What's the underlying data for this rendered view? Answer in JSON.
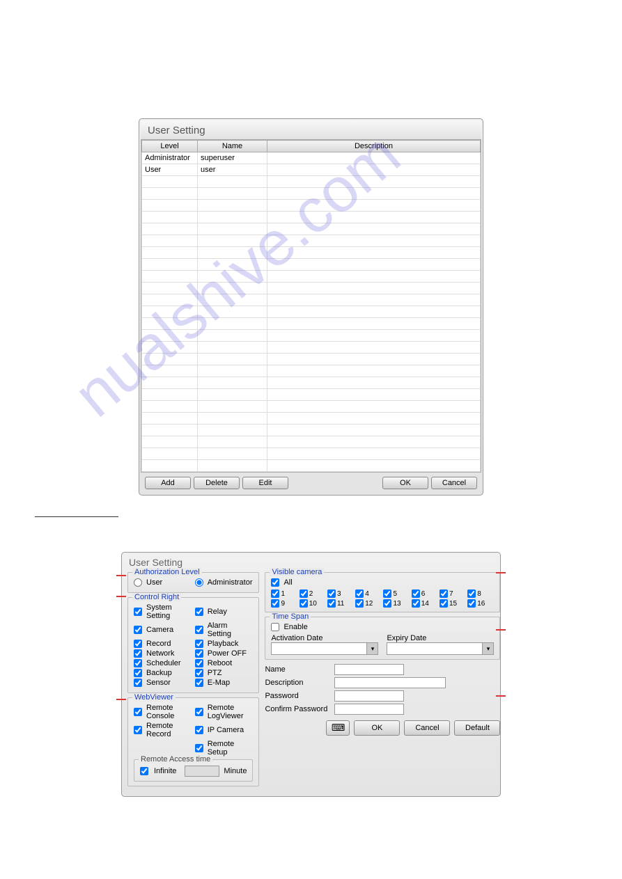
{
  "dialog1": {
    "title": "User Setting",
    "headers": {
      "level": "Level",
      "name": "Name",
      "description": "Description"
    },
    "rows": [
      {
        "level": "Administrator",
        "name": "superuser",
        "description": ""
      },
      {
        "level": "User",
        "name": "user",
        "description": ""
      }
    ],
    "buttons": {
      "add": "Add",
      "delete": "Delete",
      "edit": "Edit",
      "ok": "OK",
      "cancel": "Cancel"
    }
  },
  "dialog2": {
    "title": "User Setting",
    "auth": {
      "title": "Authorization Level",
      "user": "User",
      "admin": "Administrator"
    },
    "control": {
      "title": "Control Right",
      "left": [
        "System Setting",
        "Camera",
        "Record",
        "Network",
        "Scheduler",
        "Backup",
        "Sensor"
      ],
      "right": [
        "Relay",
        "Alarm Setting",
        "Playback",
        "Power OFF",
        "Reboot",
        "PTZ",
        "E-Map"
      ]
    },
    "webviewer": {
      "title": "WebViewer",
      "left": [
        "Remote Console",
        "Remote Record"
      ],
      "right": [
        "Remote LogViewer",
        "IP Camera",
        "Remote Setup"
      ]
    },
    "remote_access": {
      "title": "Remote Access time",
      "infinite": "Infinite",
      "minute": "Minute"
    },
    "visible": {
      "title": "Visible camera",
      "all": "All",
      "cams": [
        "1",
        "2",
        "3",
        "4",
        "5",
        "6",
        "7",
        "8",
        "9",
        "10",
        "11",
        "12",
        "13",
        "14",
        "15",
        "16"
      ]
    },
    "timespan": {
      "title": "Time Span",
      "enable": "Enable",
      "activation": "Activation Date",
      "expiry": "Expiry Date"
    },
    "form": {
      "name": "Name",
      "description": "Description",
      "password": "Password",
      "confirm": "Confirm Password"
    },
    "buttons": {
      "ok": "OK",
      "cancel": "Cancel",
      "default": "Default"
    }
  }
}
